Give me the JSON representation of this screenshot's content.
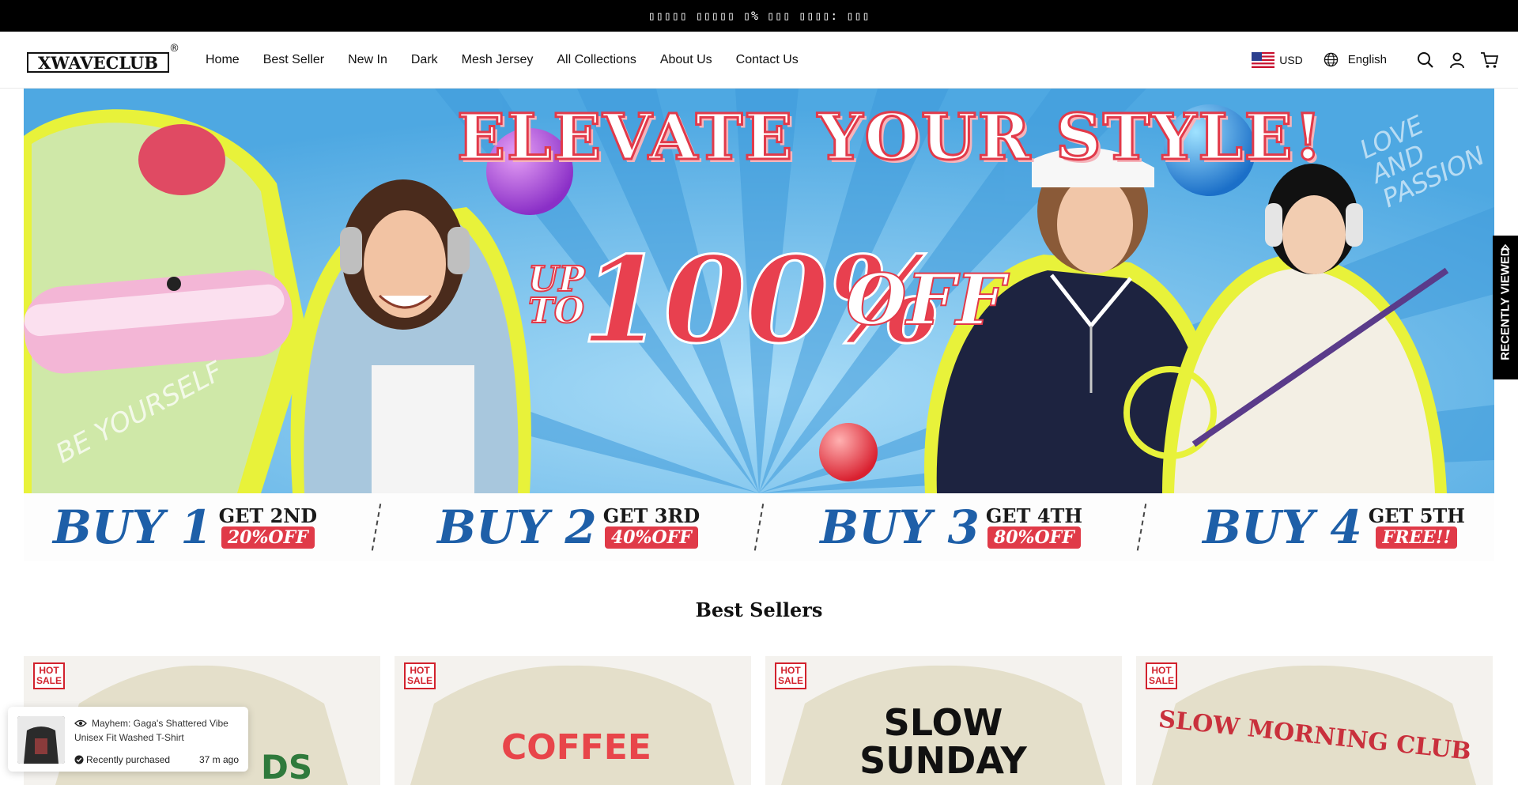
{
  "announcement": {
    "text": "▯▯▯▯▯ ▯▯▯▯▯ ▯% ▯▯▯ ▯▯▯▯: ▯▯▯"
  },
  "header": {
    "logo": {
      "text": "XWAVECLUB",
      "reg_mark": "®"
    },
    "nav": [
      "Home",
      "Best Seller",
      "New In",
      "Dark",
      "Mesh Jersey",
      "All Collections",
      "About Us",
      "Contact Us"
    ],
    "currency": "USD",
    "language": "English",
    "icons": [
      "search-icon",
      "account-icon",
      "cart-icon"
    ]
  },
  "hero": {
    "headline": "ELEVATE YOUR STYLE!",
    "up_to": "UP TO",
    "up_line1": "UP",
    "up_line2": "TO",
    "percent": "100%",
    "off": "OFF",
    "side_text_left": "BE YOURSELF",
    "side_text_right_1": "LOVE",
    "side_text_right_2": "AND",
    "side_text_right_3": "PASSION",
    "colors": {
      "sky": "#5fb6e8",
      "accent_red": "#e8404f",
      "highlight": "#e8f23a"
    }
  },
  "promo": {
    "deals": [
      {
        "buy": "BUY 1",
        "get": "GET 2ND",
        "off": "20%OFF"
      },
      {
        "buy": "BUY 2",
        "get": "GET 3RD",
        "off": "40%OFF"
      },
      {
        "buy": "BUY 3",
        "get": "GET 4TH",
        "off": "80%OFF"
      },
      {
        "buy": "BUY 4",
        "get": "GET 5TH",
        "off": "FREE!!"
      }
    ]
  },
  "best_sellers": {
    "title": "Best Sellers",
    "badge_line1": "HOT",
    "badge_line2": "SALE",
    "products": [
      {
        "print": "DS"
      },
      {
        "print": "COFFEE"
      },
      {
        "print": "SLOW SUNDAY",
        "print_line1": "SLOW",
        "print_line2": "SUNDAY"
      },
      {
        "print": "SLOW MORNING CLUB"
      }
    ]
  },
  "recently_viewed": {
    "label": "RECENTLY VIEWED"
  },
  "toast": {
    "title": "Mayhem: Gaga's Shattered Vibe Unisex Fit Washed T-Shirt",
    "status": "Recently purchased",
    "time": "37 m ago"
  }
}
